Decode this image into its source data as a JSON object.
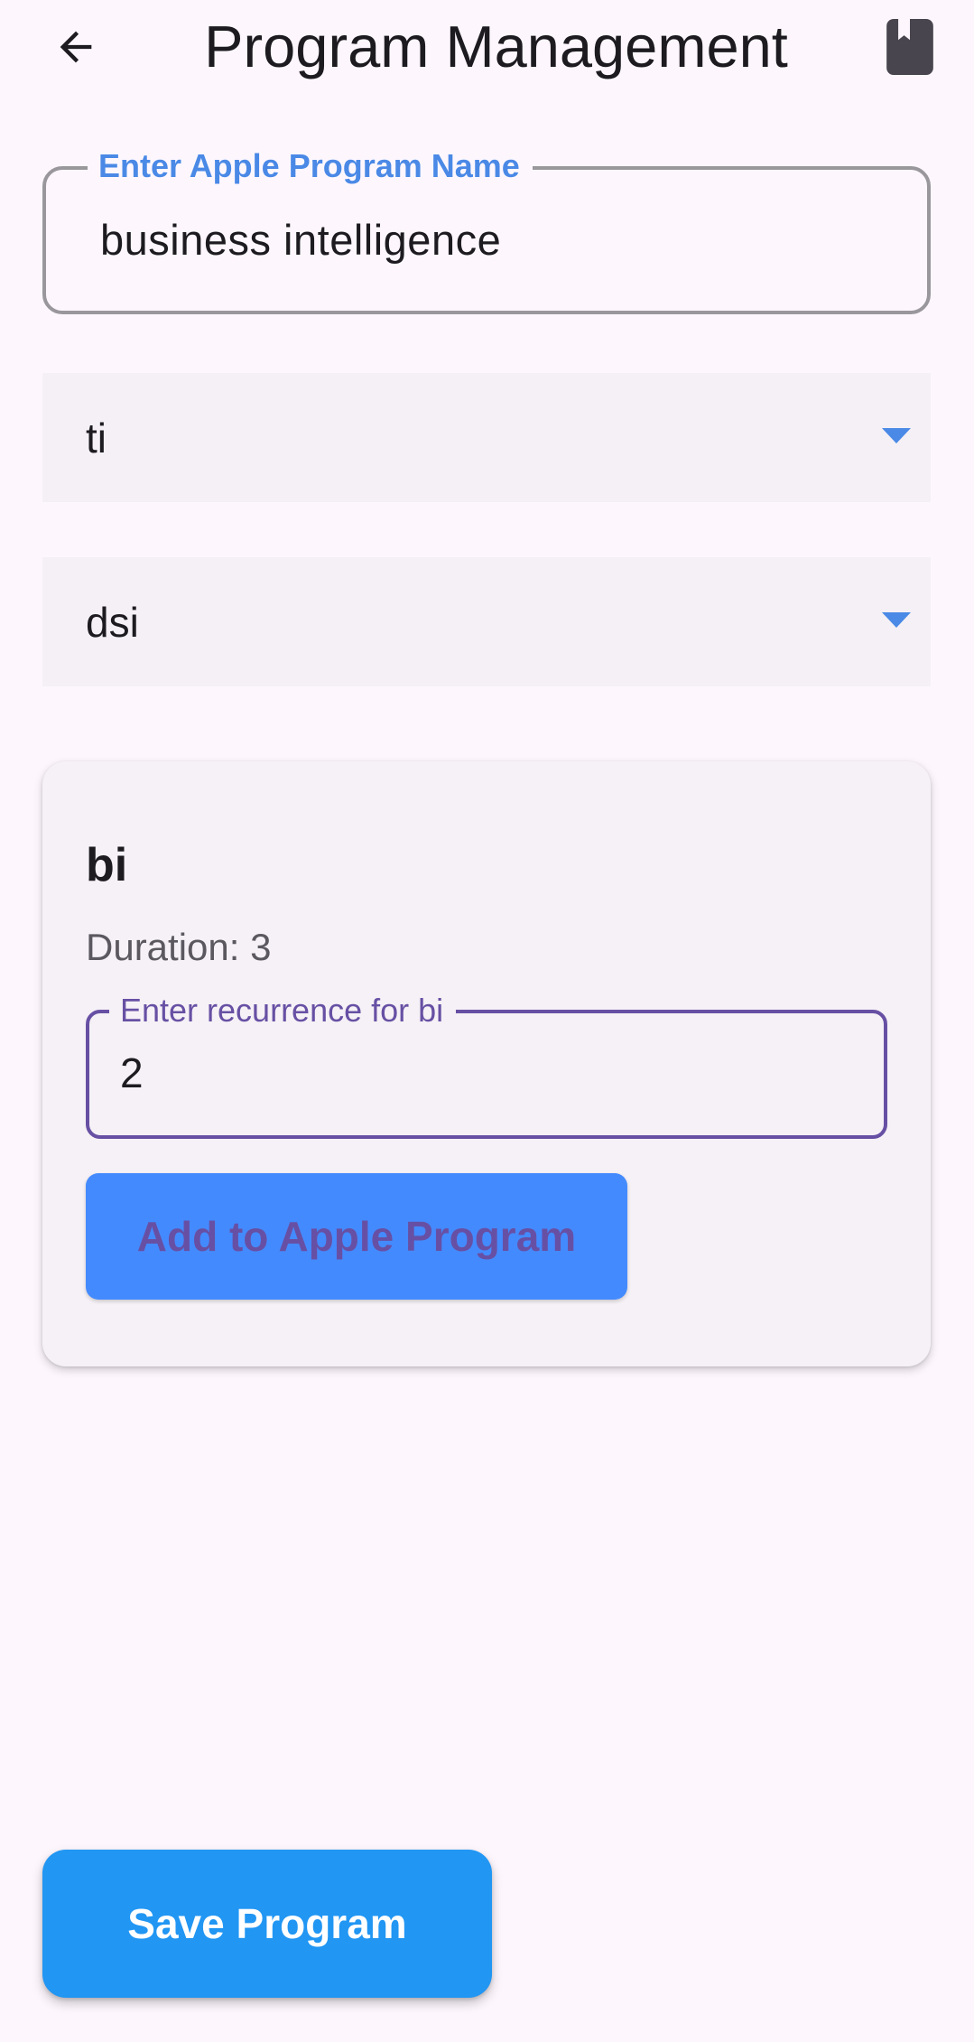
{
  "app_bar": {
    "title": "Program Management",
    "back_icon": "arrow-back-icon",
    "action_icon": "bookmark-book-icon"
  },
  "program_name_field": {
    "label": "Enter Apple Program Name",
    "value": "business intelligence"
  },
  "dropdowns": [
    {
      "value": "ti"
    },
    {
      "value": "dsi"
    }
  ],
  "course_card": {
    "title": "bi",
    "duration_text": "Duration: 3",
    "recurrence_label": "Enter recurrence for bi",
    "recurrence_value": "2",
    "add_button_label": "Add to Apple Program"
  },
  "save_button_label": "Save Program",
  "colors": {
    "background": "#fdf7fd",
    "accent_blue": "#4a89e6",
    "add_button_blue": "#448aff",
    "save_button_blue": "#2196f3",
    "purple": "#6750a4",
    "field_fill": "#f4f0f5"
  }
}
